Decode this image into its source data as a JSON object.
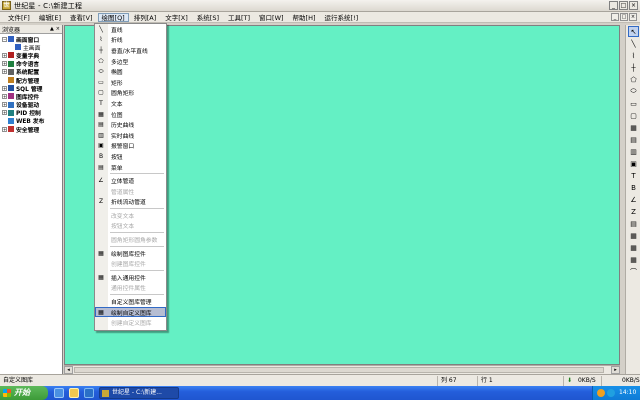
{
  "window": {
    "title": "世纪星 - C:\\新建工程",
    "app_icon": "app-icon",
    "controls": [
      "_",
      "□",
      "×"
    ]
  },
  "menubar": [
    {
      "label": "文件[F]"
    },
    {
      "label": "编辑[E]"
    },
    {
      "label": "查看[V]"
    },
    {
      "label": "绘图[Q]",
      "active": true
    },
    {
      "label": "排列[A]"
    },
    {
      "label": "文字[X]"
    },
    {
      "label": "系统[S]"
    },
    {
      "label": "工具[T]"
    },
    {
      "label": "窗口[W]"
    },
    {
      "label": "帮助[H]"
    },
    {
      "label": "运行系统[!]"
    }
  ],
  "browser": {
    "title": "浏览器",
    "controls": [
      "▲",
      "×"
    ],
    "tree": [
      {
        "label": "画面窗口",
        "exp": "−",
        "icon": "window-icon",
        "color": "#3060c0"
      },
      {
        "label": "主画面",
        "child": true,
        "icon": "page-icon",
        "color": "#3060c0"
      },
      {
        "label": "变量字典",
        "exp": "+",
        "icon": "dictionary-icon",
        "color": "#b02020"
      },
      {
        "label": "命令语言",
        "exp": "+",
        "icon": "script-icon",
        "color": "#208040"
      },
      {
        "label": "系统配置",
        "exp": "+",
        "icon": "config-icon",
        "color": "#606060"
      },
      {
        "label": "配方管理",
        "icon": "recipe-icon",
        "color": "#c08020"
      },
      {
        "label": "SQL 管理",
        "exp": "+",
        "icon": "sql-icon",
        "color": "#2050a0"
      },
      {
        "label": "图库控件",
        "exp": "+",
        "icon": "library-icon",
        "color": "#a03080"
      },
      {
        "label": "设备驱动",
        "exp": "+",
        "icon": "driver-icon",
        "color": "#3070c0"
      },
      {
        "label": "PID 控制",
        "exp": "+",
        "icon": "pid-icon",
        "color": "#208080"
      },
      {
        "label": "WEB 发布",
        "icon": "web-icon",
        "color": "#3080d0"
      },
      {
        "label": "安全管理",
        "exp": "+",
        "icon": "security-icon",
        "color": "#c03030"
      }
    ]
  },
  "draw_menu": {
    "items": [
      {
        "label": "直线",
        "icon": "line-icon",
        "glyph": "╲"
      },
      {
        "label": "折线",
        "icon": "polyline-icon",
        "glyph": "⌇"
      },
      {
        "label": "垂直/水平直线",
        "icon": "orthogonal-line-icon",
        "glyph": "┼"
      },
      {
        "label": "多边型",
        "icon": "polygon-icon",
        "glyph": "⬠"
      },
      {
        "label": "椭圆",
        "icon": "ellipse-icon",
        "glyph": "⬭"
      },
      {
        "label": "矩形",
        "icon": "rectangle-icon",
        "glyph": "▭"
      },
      {
        "label": "圆角矩形",
        "icon": "rounded-rectangle-icon",
        "glyph": "▢"
      },
      {
        "label": "文本",
        "icon": "text-icon",
        "glyph": "T"
      },
      {
        "label": "位图",
        "icon": "bitmap-icon",
        "glyph": "▦"
      },
      {
        "label": "历史曲线",
        "icon": "history-trend-icon",
        "glyph": "▤"
      },
      {
        "label": "实时曲线",
        "icon": "realtime-trend-icon",
        "glyph": "▥"
      },
      {
        "label": "报警窗口",
        "icon": "alarm-window-icon",
        "glyph": "▣"
      },
      {
        "label": "按钮",
        "icon": "button-icon",
        "glyph": "B"
      },
      {
        "label": "菜单",
        "icon": "menu-icon",
        "glyph": "▤"
      },
      {
        "sep": true
      },
      {
        "label": "立体管道",
        "icon": "pipe-icon",
        "glyph": "∠"
      },
      {
        "label": "管道属性",
        "disabled": true
      },
      {
        "label": "折线流动管道",
        "icon": "flow-pipe-icon",
        "glyph": "Z"
      },
      {
        "sep": true
      },
      {
        "label": "改变文本",
        "disabled": true
      },
      {
        "label": "按钮文本",
        "disabled": true
      },
      {
        "sep": true
      },
      {
        "label": "圆角矩形圆角参数",
        "disabled": true
      },
      {
        "sep": true
      },
      {
        "label": "绘制图库控件",
        "icon": "draw-library-icon",
        "glyph": "▦"
      },
      {
        "label": "创建图库控件",
        "disabled": true
      },
      {
        "sep": true
      },
      {
        "label": "插入通用控件",
        "icon": "insert-control-icon",
        "glyph": "▦"
      },
      {
        "label": "通用控件属性",
        "disabled": true
      },
      {
        "sep": true
      },
      {
        "label": "自定义图库管理"
      },
      {
        "label": "绘制自定义图库",
        "icon": "draw-custom-library-icon",
        "glyph": "▦",
        "highlight": true
      },
      {
        "label": "创建自定义图库",
        "disabled": true
      }
    ]
  },
  "right_toolbar": [
    {
      "icon": "pointer-icon",
      "glyph": "↖",
      "selected": true
    },
    {
      "icon": "line-icon",
      "glyph": "╲"
    },
    {
      "icon": "polyline-icon",
      "glyph": "⌇"
    },
    {
      "icon": "orthogonal-line-icon",
      "glyph": "┼"
    },
    {
      "icon": "polygon-icon",
      "glyph": "⬠"
    },
    {
      "icon": "ellipse-icon",
      "glyph": "⬭"
    },
    {
      "icon": "rectangle-icon",
      "glyph": "▭"
    },
    {
      "icon": "rounded-rectangle-icon",
      "glyph": "▢"
    },
    {
      "icon": "bitmap-icon",
      "glyph": "▦"
    },
    {
      "icon": "history-trend-icon",
      "glyph": "▤"
    },
    {
      "icon": "realtime-trend-icon",
      "glyph": "▥"
    },
    {
      "icon": "alarm-window-icon",
      "glyph": "▣"
    },
    {
      "icon": "text-icon",
      "glyph": "T"
    },
    {
      "icon": "button-icon",
      "glyph": "B"
    },
    {
      "icon": "pipe-icon",
      "glyph": "∠"
    },
    {
      "icon": "flow-pipe-icon",
      "glyph": "Z"
    },
    {
      "icon": "menu-icon",
      "glyph": "▤"
    },
    {
      "icon": "library-icon",
      "glyph": "▦"
    },
    {
      "icon": "control-icon",
      "glyph": "▦"
    },
    {
      "icon": "custom-library-icon",
      "glyph": "▦"
    },
    {
      "icon": "pipe-style-icon",
      "glyph": "⌒"
    }
  ],
  "statusbar": {
    "message": "自定义图库",
    "col": "列 67",
    "row": "行 1",
    "net_up": "0KB/S",
    "net_down": "0KB/S"
  },
  "taskbar": {
    "start_label": "开始",
    "task_label": "世纪星 - C:\\新建...",
    "clock": "14:10"
  }
}
